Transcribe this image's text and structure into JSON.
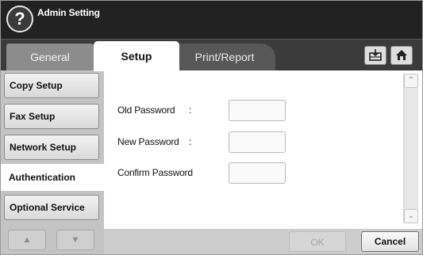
{
  "window": {
    "title": "Admin Setting",
    "help_glyph": "?"
  },
  "tabs": [
    {
      "label": "General"
    },
    {
      "label": "Setup",
      "active": true
    },
    {
      "label": "Print/Report"
    }
  ],
  "toolbar": {
    "buttons": [
      {
        "icon": "inbox-tray-icon"
      },
      {
        "icon": "home-icon"
      }
    ]
  },
  "sidebar": {
    "items": [
      {
        "label": "Copy Setup"
      },
      {
        "label": "Fax Setup"
      },
      {
        "label": "Network Setup"
      },
      {
        "label": "Authentication",
        "active": true
      },
      {
        "label": "Optional Service"
      }
    ],
    "nav": {
      "up_glyph": "▲",
      "down_glyph": "▼"
    }
  },
  "form": {
    "old_password": {
      "label": "Old Password",
      "colon": ":",
      "value": ""
    },
    "new_password": {
      "label": "New Password",
      "colon": ":",
      "value": ""
    },
    "confirm_password": {
      "label": "Confirm Password",
      "colon": ":",
      "value": ""
    }
  },
  "scrollbar": {
    "up_glyph": "⌃",
    "down_glyph": "⌄"
  },
  "footer": {
    "ok_label": "OK",
    "cancel_label": "Cancel"
  },
  "colors": {
    "title_bar": "#222222",
    "tab_bar": "#3b3b3b",
    "sidebar": "#c4c4c4",
    "panel": "#ffffff"
  }
}
